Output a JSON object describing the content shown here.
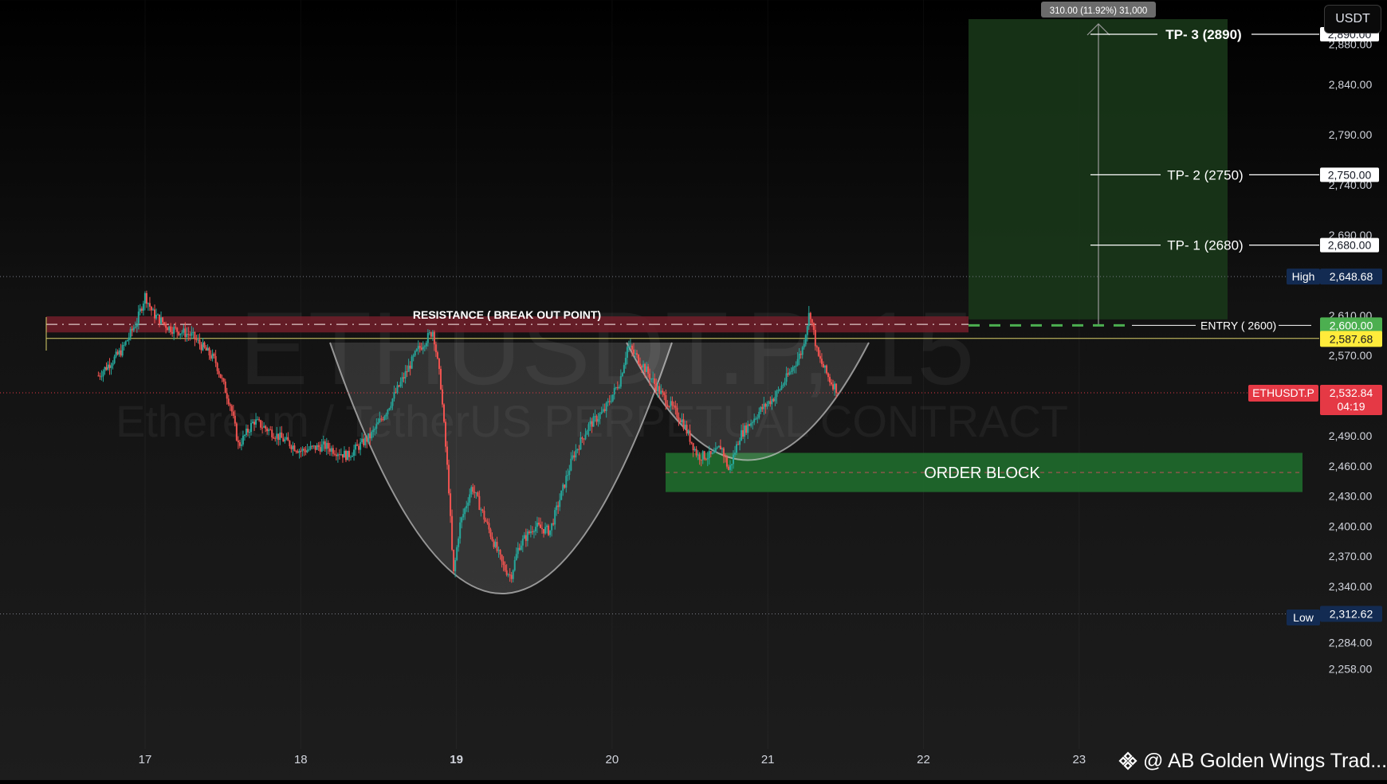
{
  "chart_data": {
    "type": "candlestick",
    "watermark": {
      "symbol": "ETHUSDT.P, 15",
      "description": "Ethereum / TetherUS PERPETUAL CONTRACT"
    },
    "currency": "USDT",
    "x_ticks": [
      {
        "label": "17",
        "bold": false
      },
      {
        "label": "18",
        "bold": false
      },
      {
        "label": "19",
        "bold": true
      },
      {
        "label": "20",
        "bold": false
      },
      {
        "label": "21",
        "bold": false
      },
      {
        "label": "22",
        "bold": false
      },
      {
        "label": "23",
        "bold": false
      }
    ],
    "y_ticks": [
      2840,
      2790,
      2740,
      2690,
      2610,
      2570,
      2490,
      2460,
      2430,
      2400,
      2370,
      2340,
      2284,
      2258
    ],
    "y_range": [
      2250,
      2905
    ],
    "price_series": [
      [
        16.7,
        2550
      ],
      [
        16.85,
        2575
      ],
      [
        16.95,
        2605
      ],
      [
        17.0,
        2630
      ],
      [
        17.05,
        2612
      ],
      [
        17.15,
        2598
      ],
      [
        17.3,
        2590
      ],
      [
        17.45,
        2565
      ],
      [
        17.55,
        2520
      ],
      [
        17.6,
        2480
      ],
      [
        17.7,
        2505
      ],
      [
        17.85,
        2490
      ],
      [
        18.0,
        2475
      ],
      [
        18.15,
        2480
      ],
      [
        18.3,
        2470
      ],
      [
        18.45,
        2490
      ],
      [
        18.55,
        2515
      ],
      [
        18.65,
        2545
      ],
      [
        18.75,
        2575
      ],
      [
        18.85,
        2595
      ],
      [
        18.9,
        2540
      ],
      [
        18.95,
        2440
      ],
      [
        18.98,
        2350
      ],
      [
        19.02,
        2400
      ],
      [
        19.1,
        2440
      ],
      [
        19.2,
        2400
      ],
      [
        19.3,
        2360
      ],
      [
        19.35,
        2350
      ],
      [
        19.4,
        2380
      ],
      [
        19.5,
        2400
      ],
      [
        19.6,
        2395
      ],
      [
        19.65,
        2420
      ],
      [
        19.75,
        2470
      ],
      [
        19.85,
        2500
      ],
      [
        19.95,
        2515
      ],
      [
        20.05,
        2545
      ],
      [
        20.1,
        2580
      ],
      [
        20.2,
        2560
      ],
      [
        20.3,
        2535
      ],
      [
        20.45,
        2505
      ],
      [
        20.55,
        2470
      ],
      [
        20.65,
        2470
      ],
      [
        20.7,
        2480
      ],
      [
        20.75,
        2455
      ],
      [
        20.82,
        2490
      ],
      [
        20.95,
        2515
      ],
      [
        21.05,
        2530
      ],
      [
        21.15,
        2555
      ],
      [
        21.22,
        2575
      ],
      [
        21.27,
        2615
      ],
      [
        21.32,
        2570
      ],
      [
        21.4,
        2545
      ],
      [
        21.45,
        2535
      ]
    ],
    "annotations": {
      "resistance_label": "RESISTANCE ( BREAK OUT POINT)",
      "entry_label": "ENTRY ( 2600)",
      "tp1_label": "TP- 1 (2680)",
      "tp2_label": "TP- 2 (2750)",
      "tp3_label": "TP- 3  (2890)",
      "order_block_label": "ORDER BLOCK",
      "measure_label": "310.00 (11.92%) 31,000",
      "entry": 2600,
      "tp1": 2680,
      "tp2": 2750,
      "tp3": 2890,
      "resistance_zone": [
        2593,
        2609
      ],
      "order_block_zone": [
        2434,
        2473
      ]
    },
    "price_badges": {
      "tp3": {
        "value": "2,890.00"
      },
      "tp2": {
        "value": "2,750.00"
      },
      "tp1": {
        "value": "2,680.00"
      },
      "high": {
        "tag": "High",
        "value": "2,648.68"
      },
      "entry": {
        "value": "2,600.00"
      },
      "prev": {
        "value": "2,587.68"
      },
      "last": {
        "tag": "ETHUSDT.P",
        "value": "2,532.84",
        "countdown": "04:19"
      },
      "low": {
        "tag": "Low",
        "value": "2,312.62"
      }
    },
    "colors": {
      "up": "#26a69a",
      "down": "#ef5350",
      "resistance": "#7a1f2b",
      "order_block": "#1f6b2c",
      "entry_badge": "#4caf50",
      "prev_badge": "#ffeb3b",
      "last_badge": "#e53945",
      "extreme_badge": "#132b52"
    }
  },
  "brand": {
    "text": "@ AB Golden Wings Trad..."
  }
}
